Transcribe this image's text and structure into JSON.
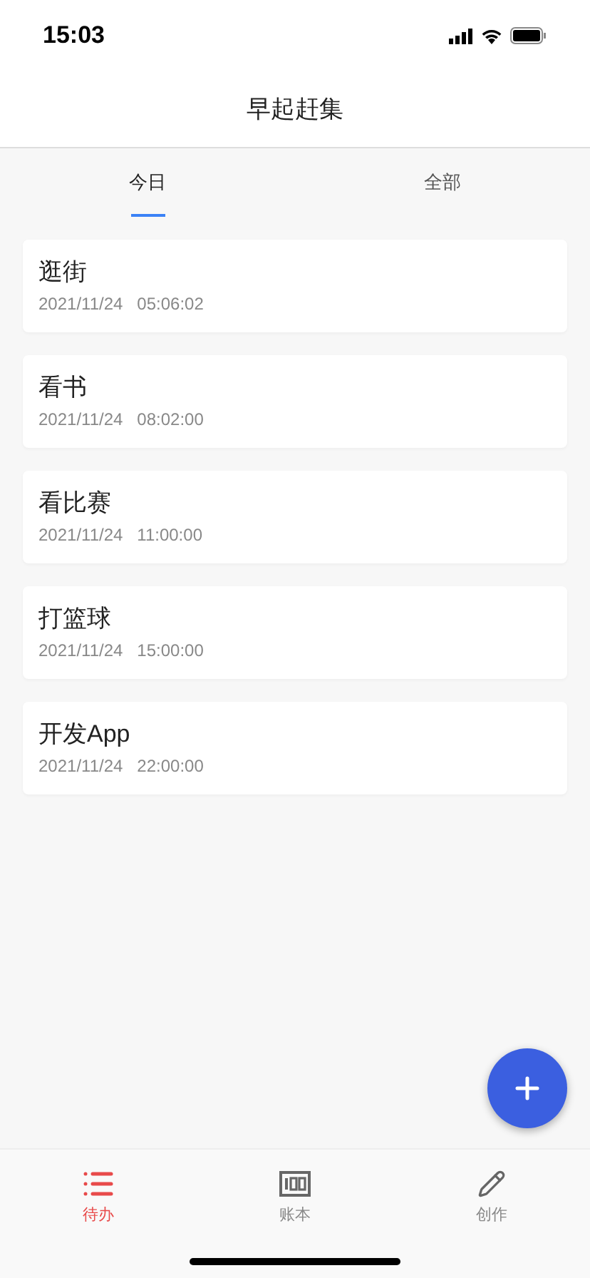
{
  "status_bar": {
    "time": "15:03"
  },
  "header": {
    "title": "早起赶集"
  },
  "tabs": [
    {
      "label": "今日",
      "selected": true
    },
    {
      "label": "全部",
      "selected": false
    }
  ],
  "tasks": [
    {
      "title": "逛街",
      "date": "2021/11/24",
      "time": "05:06:02"
    },
    {
      "title": "看书",
      "date": "2021/11/24",
      "time": "08:02:00"
    },
    {
      "title": "看比赛",
      "date": "2021/11/24",
      "time": "11:00:00"
    },
    {
      "title": "打篮球",
      "date": "2021/11/24",
      "time": "15:00:00"
    },
    {
      "title": "开发App",
      "date": "2021/11/24",
      "time": "22:00:00"
    }
  ],
  "bottom_nav": [
    {
      "label": "待办",
      "kind": "list",
      "selected": true
    },
    {
      "label": "账本",
      "kind": "ledger",
      "selected": false
    },
    {
      "label": "创作",
      "kind": "pencil",
      "selected": false
    }
  ]
}
